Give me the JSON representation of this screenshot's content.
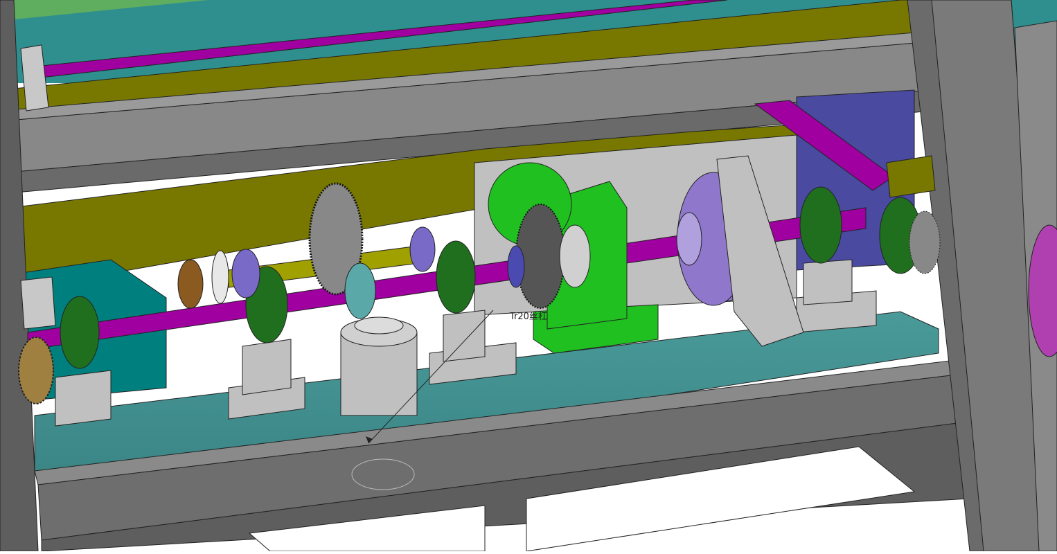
{
  "viewport": {
    "annotation_label": "Tr20丝杠"
  },
  "colors": {
    "frame_gray": "#7d7d7d",
    "frame_light": "#a8a8a8",
    "frame_dark": "#555555",
    "olive": "#787800",
    "teal_plate": "#3f8c8c",
    "teal_dark": "#007f7f",
    "magenta_shaft": "#a000a0",
    "yellow_shaft": "#a0a000",
    "green_housing": "#1fc01f",
    "dark_green_bearing": "#1f6f1f",
    "lavender_pulley": "#8f77cc",
    "blue_slate": "#4a4aa0",
    "bronze_gear": "#a08040",
    "light_gray_parts": "#c8c8c8"
  }
}
